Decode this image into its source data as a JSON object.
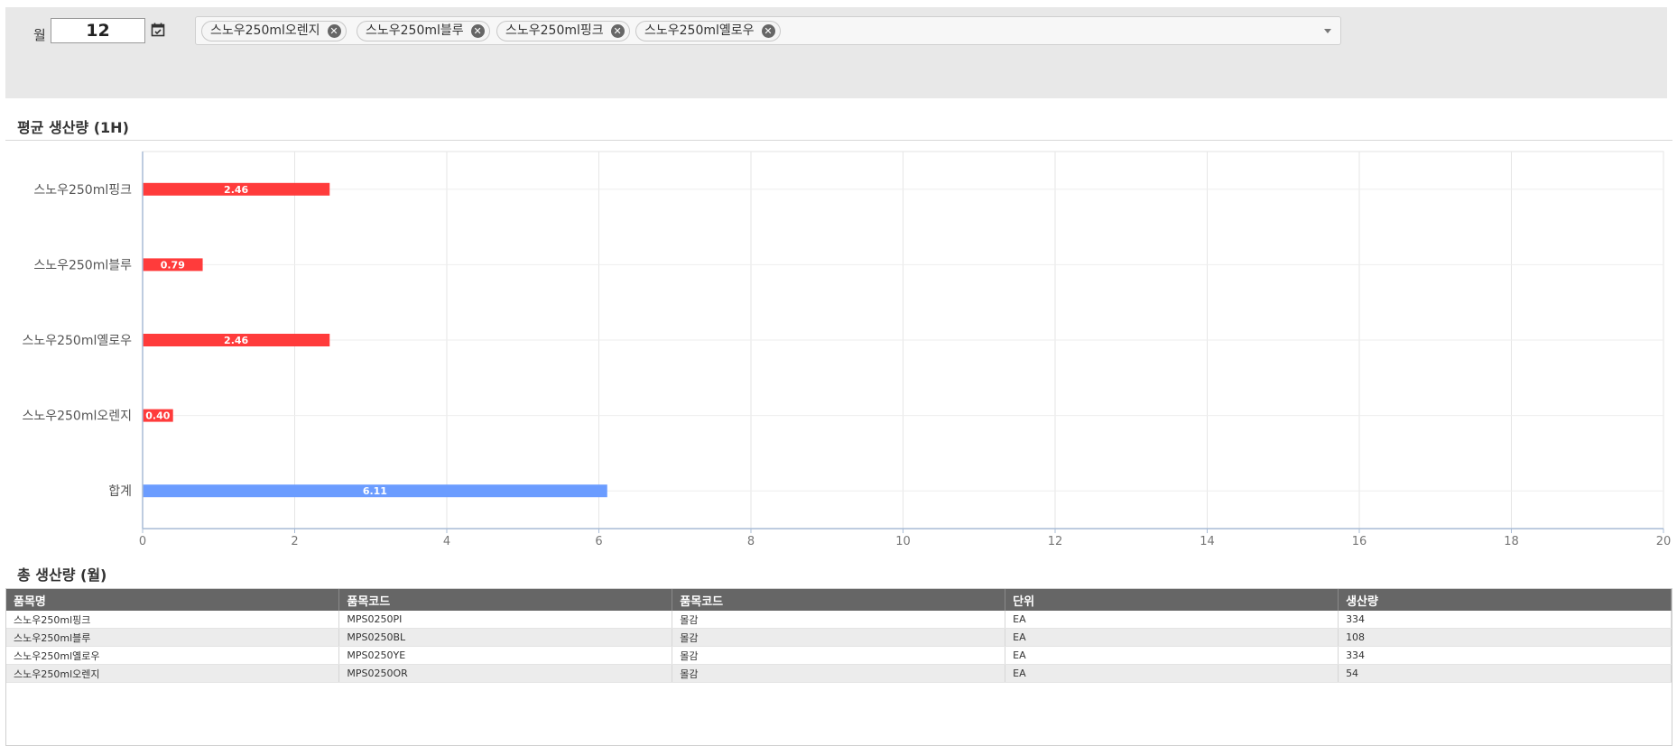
{
  "filter": {
    "month_label": "월",
    "month_value": "12",
    "selected_items": [
      "스노우250ml오렌지",
      "스노우250ml블루",
      "스노우250ml핑크",
      "스노우250ml옐로우"
    ]
  },
  "section_avg_title": "평균 생산량 (1H)",
  "section_total_title": "총 생산량 (월)",
  "chart_data": {
    "type": "bar",
    "orientation": "horizontal",
    "title": "평균 생산량 (1H)",
    "categories": [
      "스노우250ml핑크",
      "스노우250ml블루",
      "스노우250ml옐로우",
      "스노우250ml오렌지",
      "합계"
    ],
    "values": [
      2.46,
      0.79,
      2.46,
      0.4,
      6.11
    ],
    "value_labels": [
      "2.46",
      "0.79",
      "2.46",
      "0.40",
      "6.11"
    ],
    "bar_colors": [
      "#ff3b3b",
      "#ff3b3b",
      "#ff3b3b",
      "#ff3b3b",
      "#6b9cff"
    ],
    "xlim": [
      0,
      20
    ],
    "xticks": [
      0,
      2,
      4,
      6,
      8,
      10,
      12,
      14,
      16,
      18,
      20
    ],
    "grid": true,
    "legend": "none"
  },
  "table": {
    "columns": [
      "품목명",
      "품목코드",
      "품목코드",
      "단위",
      "생산량"
    ],
    "rows": [
      [
        "스노우250ml핑크",
        "MPS0250PI",
        "몰감",
        "EA",
        "334"
      ],
      [
        "스노우250ml블루",
        "MPS0250BL",
        "몰감",
        "EA",
        "108"
      ],
      [
        "스노우250ml옐로우",
        "MPS0250YE",
        "몰감",
        "EA",
        "334"
      ],
      [
        "스노우250ml오렌지",
        "MPS0250OR",
        "몰감",
        "EA",
        "54"
      ]
    ]
  },
  "colors": {
    "bar_item": "#ff3b3b",
    "bar_total": "#6b9cff",
    "table_header": "#666666",
    "filter_bg": "#e8e8e8"
  }
}
